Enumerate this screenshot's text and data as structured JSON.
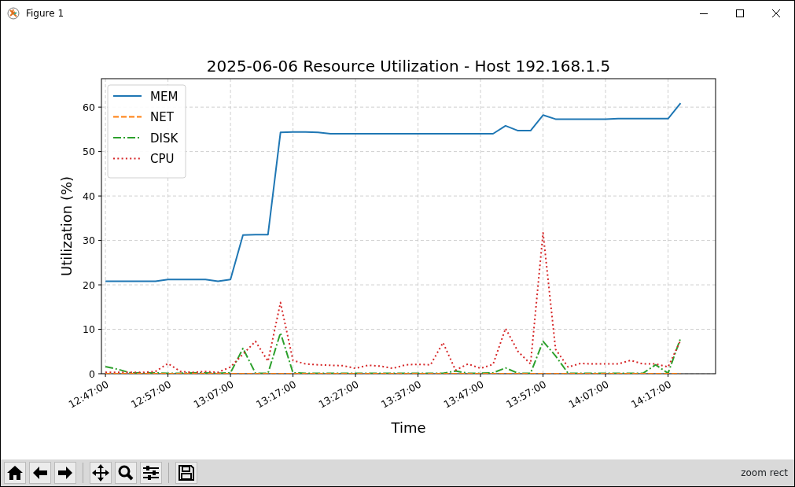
{
  "window": {
    "title": "Figure 1"
  },
  "figure": {
    "chart_data": {
      "type": "line",
      "title": "2025-06-06 Resource Utilization - Host 192.168.1.5",
      "xlabel": "Time",
      "ylabel": "Utilization (%)",
      "categories": [
        "12:47:00",
        null,
        null,
        null,
        null,
        "12:57:00",
        null,
        null,
        null,
        null,
        "13:07:00",
        null,
        null,
        null,
        null,
        "13:17:00",
        null,
        null,
        null,
        null,
        "13:27:00",
        null,
        null,
        null,
        null,
        "13:37:00",
        null,
        null,
        null,
        null,
        "13:47:00",
        null,
        null,
        null,
        null,
        "13:57:00",
        null,
        null,
        null,
        null,
        "14:07:00",
        null,
        null,
        null,
        null,
        "14:17:00",
        null
      ],
      "series": [
        {
          "name": "MEM",
          "color": "#1f77b4",
          "line_style": "solid",
          "values": [
            20.8,
            20.8,
            20.8,
            20.8,
            20.8,
            21.2,
            21.2,
            21.2,
            21.2,
            20.8,
            21.2,
            31.2,
            31.3,
            31.3,
            54.3,
            54.4,
            54.4,
            54.3,
            54.0,
            54.0,
            54.0,
            54.0,
            54.0,
            54.0,
            54.0,
            54.0,
            54.0,
            54.0,
            54.0,
            54.0,
            54.0,
            54.0,
            55.8,
            54.7,
            54.7,
            58.2,
            57.3,
            57.3,
            57.3,
            57.3,
            57.3,
            57.4,
            57.4,
            57.4,
            57.4,
            57.4,
            60.9
          ]
        },
        {
          "name": "NET",
          "color": "#ff7f0e",
          "line_style": "dashed",
          "values": [
            0,
            0,
            0,
            0,
            0,
            0,
            0,
            0,
            0,
            0,
            0,
            0,
            0,
            0,
            0,
            0,
            0,
            0,
            0,
            0,
            0,
            0,
            0,
            0,
            0,
            0,
            0,
            0,
            0,
            0,
            0,
            0,
            0,
            0,
            0,
            0,
            0,
            0,
            0,
            0,
            0,
            0,
            0,
            0,
            0,
            0,
            0
          ]
        },
        {
          "name": "DISK",
          "color": "#2ca02c",
          "line_style": "dashdot",
          "values": [
            1.6,
            1.0,
            0.2,
            0.2,
            0.2,
            0.1,
            0.1,
            0.2,
            0.2,
            0.1,
            0.2,
            5.7,
            0.1,
            0.1,
            9.2,
            0.2,
            0.1,
            0.1,
            0.1,
            0.1,
            0.1,
            0.1,
            0.1,
            0.1,
            0.1,
            0.1,
            0.1,
            0.1,
            0.6,
            0.1,
            0.1,
            0.2,
            1.3,
            0.1,
            0.1,
            7.3,
            4.0,
            0.1,
            0.1,
            0.1,
            0.1,
            0.1,
            0.1,
            0.1,
            2.0,
            0.1,
            8.0
          ]
        },
        {
          "name": "CPU",
          "color": "#d62728",
          "line_style": "dotted",
          "values": [
            0.3,
            0.3,
            0.3,
            0.3,
            0.5,
            2.3,
            0.5,
            0.3,
            0.5,
            0.3,
            1.5,
            4.4,
            7.3,
            2.8,
            16.0,
            3.0,
            2.2,
            2.0,
            1.9,
            1.8,
            1.2,
            1.9,
            1.7,
            1.2,
            2.0,
            2.1,
            2.0,
            7.0,
            0.8,
            2.2,
            1.2,
            2.1,
            10.2,
            5.0,
            2.2,
            31.7,
            5.5,
            1.5,
            2.3,
            2.2,
            2.2,
            2.2,
            3.0,
            2.2,
            2.2,
            1.5,
            7.5
          ]
        }
      ],
      "ylim": [
        0,
        66.4
      ],
      "grid": true,
      "legend": "upper left",
      "yticks": [
        0,
        10,
        20,
        30,
        40,
        50,
        60
      ]
    }
  },
  "status_bar": {
    "message": "zoom rect"
  }
}
